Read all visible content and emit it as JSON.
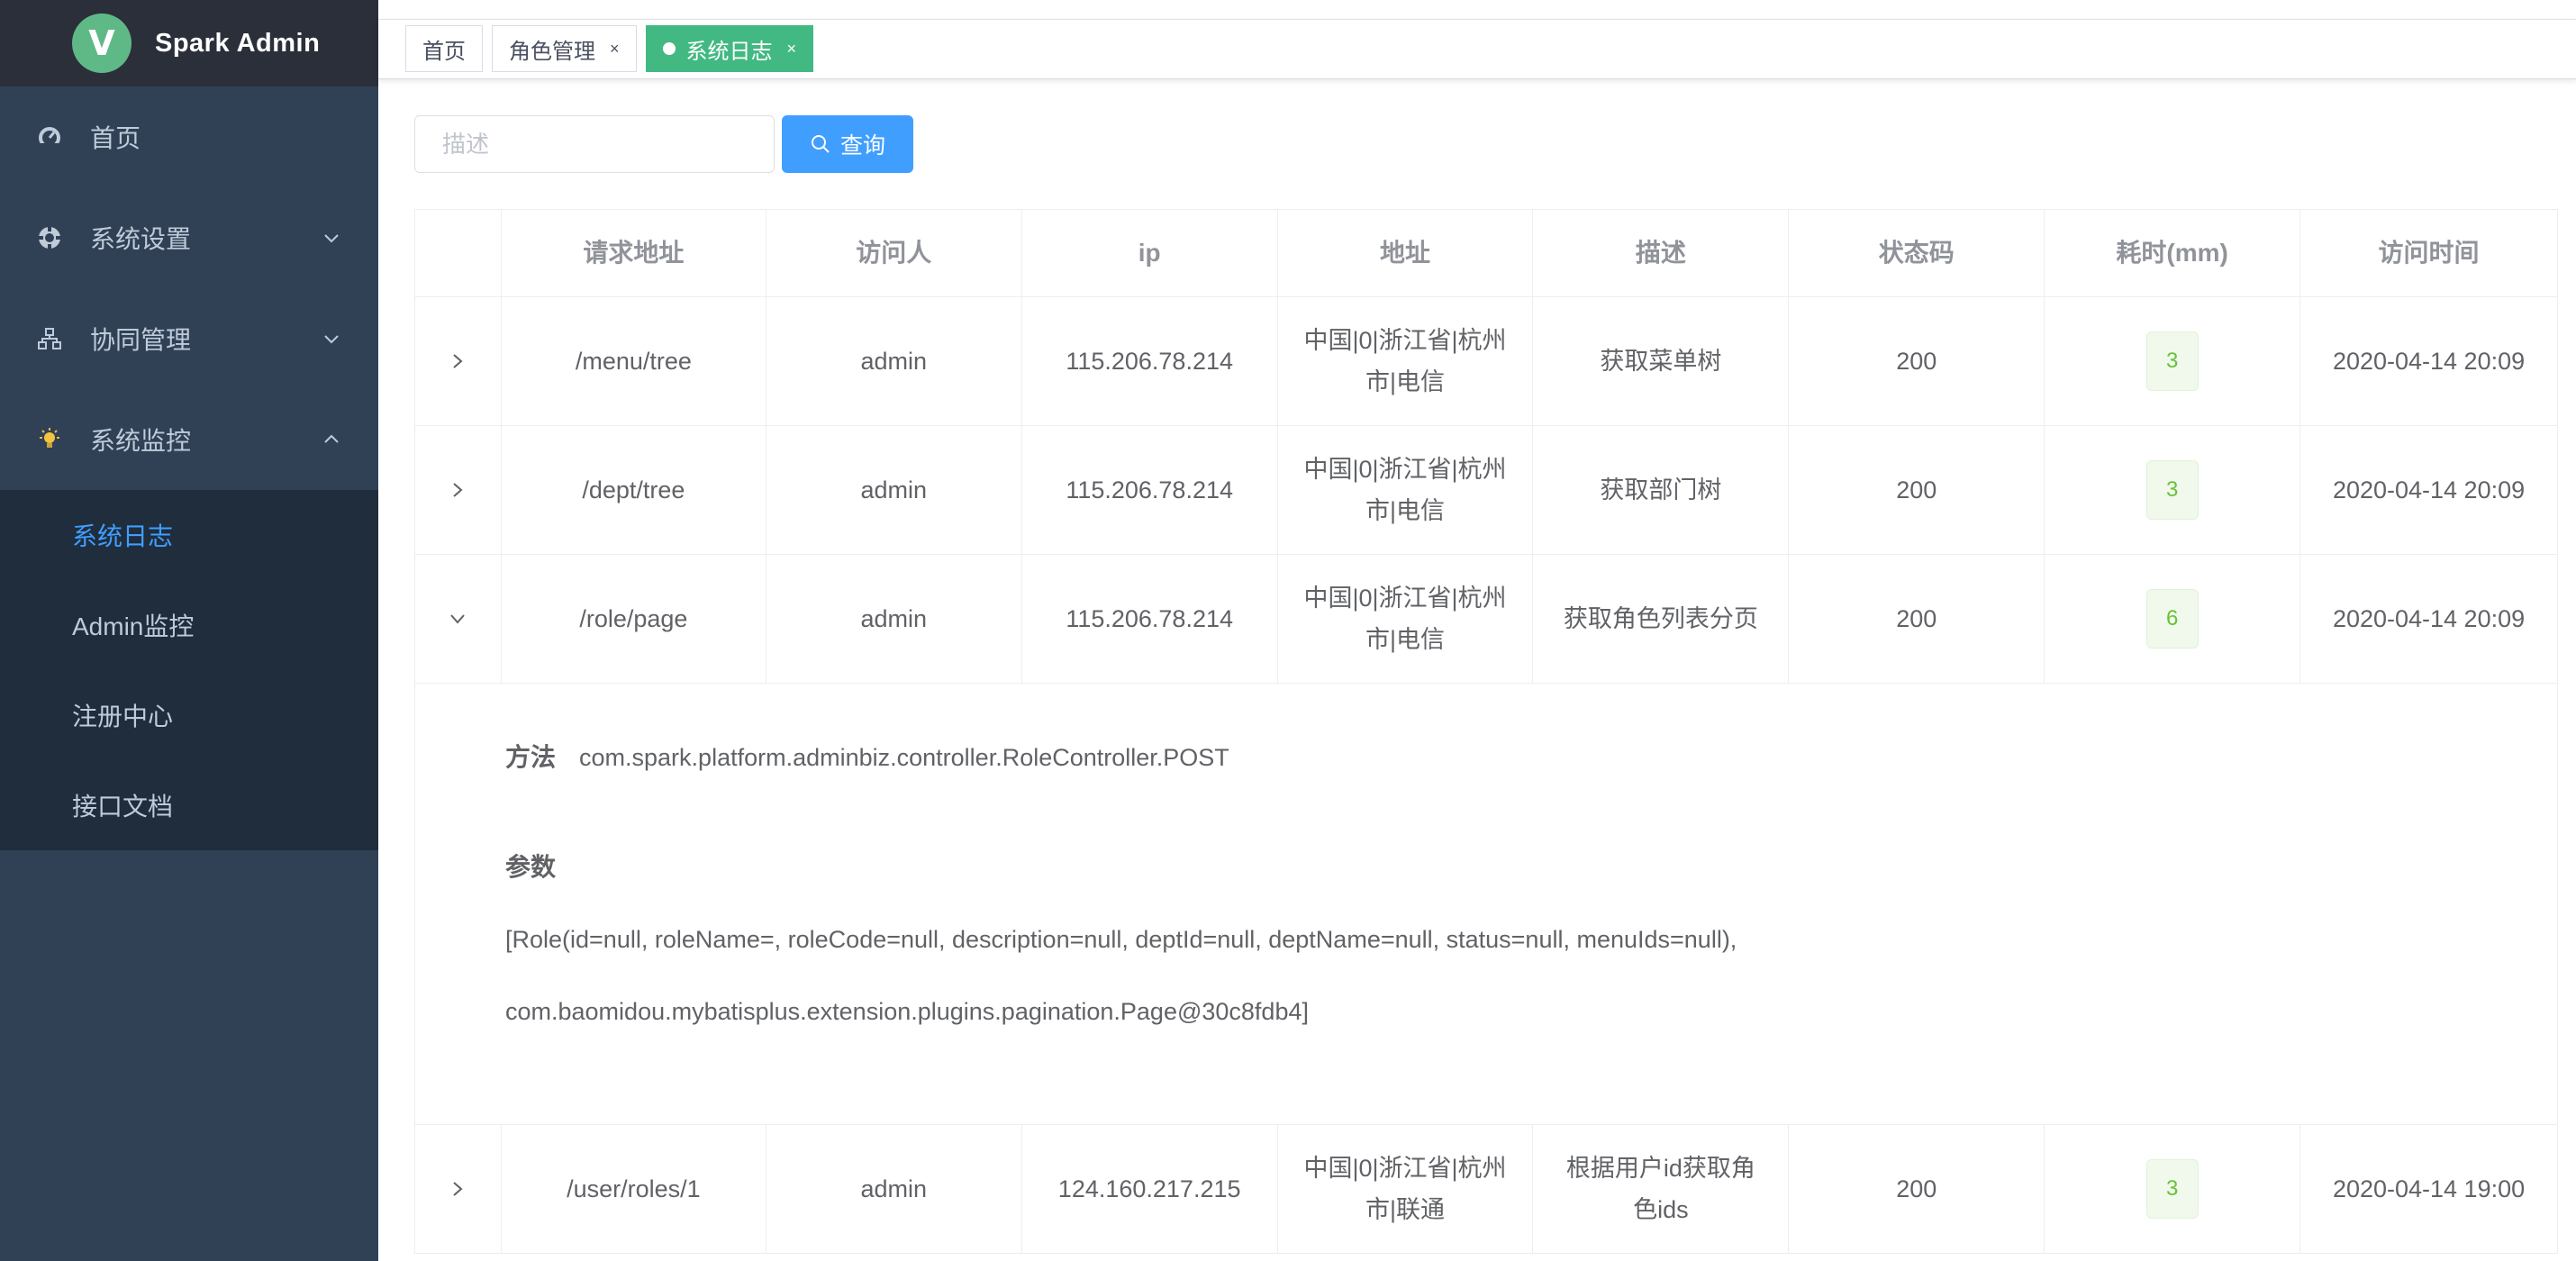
{
  "app": {
    "logo_letter": "V",
    "title": "Spark Admin"
  },
  "sidebar": {
    "items": [
      {
        "label": "首页",
        "icon": "dashboard-icon"
      },
      {
        "label": "系统设置",
        "icon": "settings-gear-icon"
      },
      {
        "label": "协同管理",
        "icon": "sitemap-icon"
      },
      {
        "label": "系统监控",
        "icon": "monitor-bulb-icon"
      }
    ],
    "submenu": [
      {
        "label": "系统日志",
        "active": true
      },
      {
        "label": "Admin监控"
      },
      {
        "label": "注册中心"
      },
      {
        "label": "接口文档"
      }
    ]
  },
  "tags": [
    {
      "label": "首页"
    },
    {
      "label": "角色管理",
      "close": "×"
    },
    {
      "label": "系统日志",
      "close": "×",
      "active": true
    }
  ],
  "search": {
    "placeholder": "描述",
    "button_label": "查询"
  },
  "table": {
    "headers": [
      "请求地址",
      "访问人",
      "ip",
      "地址",
      "描述",
      "状态码",
      "耗时(mm)",
      "访问时间"
    ],
    "rows": [
      {
        "url": "/menu/tree",
        "user": "admin",
        "ip": "115.206.78.214",
        "addr1": "中国|0|浙江省|杭州",
        "addr2": "市|电信",
        "desc1": "获取菜单树",
        "desc2": "",
        "status": "200",
        "time_cost": "3",
        "visit_time": "2020-04-14 20:09"
      },
      {
        "url": "/dept/tree",
        "user": "admin",
        "ip": "115.206.78.214",
        "addr1": "中国|0|浙江省|杭州",
        "addr2": "市|电信",
        "desc1": "获取部门树",
        "desc2": "",
        "status": "200",
        "time_cost": "3",
        "visit_time": "2020-04-14 20:09"
      },
      {
        "url": "/role/page",
        "user": "admin",
        "ip": "115.206.78.214",
        "addr1": "中国|0|浙江省|杭州",
        "addr2": "市|电信",
        "desc1": "获取角色列表分页",
        "desc2": "",
        "status": "200",
        "time_cost": "6",
        "visit_time": "2020-04-14 20:09"
      },
      {
        "url": "/user/roles/1",
        "user": "admin",
        "ip": "124.160.217.215",
        "addr1": "中国|0|浙江省|杭州",
        "addr2": "市|联通",
        "desc1": "根据用户id获取角",
        "desc2": "色ids",
        "status": "200",
        "time_cost": "3",
        "visit_time": "2020-04-14 19:00"
      }
    ],
    "expanded": {
      "method_label": "方法",
      "method_value": "com.spark.platform.adminbiz.controller.RoleController.POST",
      "params_label": "参数",
      "params_line1": "[Role(id=null, roleName=, roleCode=null, description=null, deptId=null, deptName=null, status=null, menuIds=null),",
      "params_line2": "com.baomidou.mybatisplus.extension.plugins.pagination.Page@30c8fdb4]"
    }
  },
  "colors": {
    "sidebar_bg": "#304156",
    "submenu_bg": "#1f2d3d",
    "logo_bar_bg": "#2b2f3a",
    "active_link": "#409eff",
    "tag_active": "#42b983",
    "badge_green": "#67c23a"
  }
}
